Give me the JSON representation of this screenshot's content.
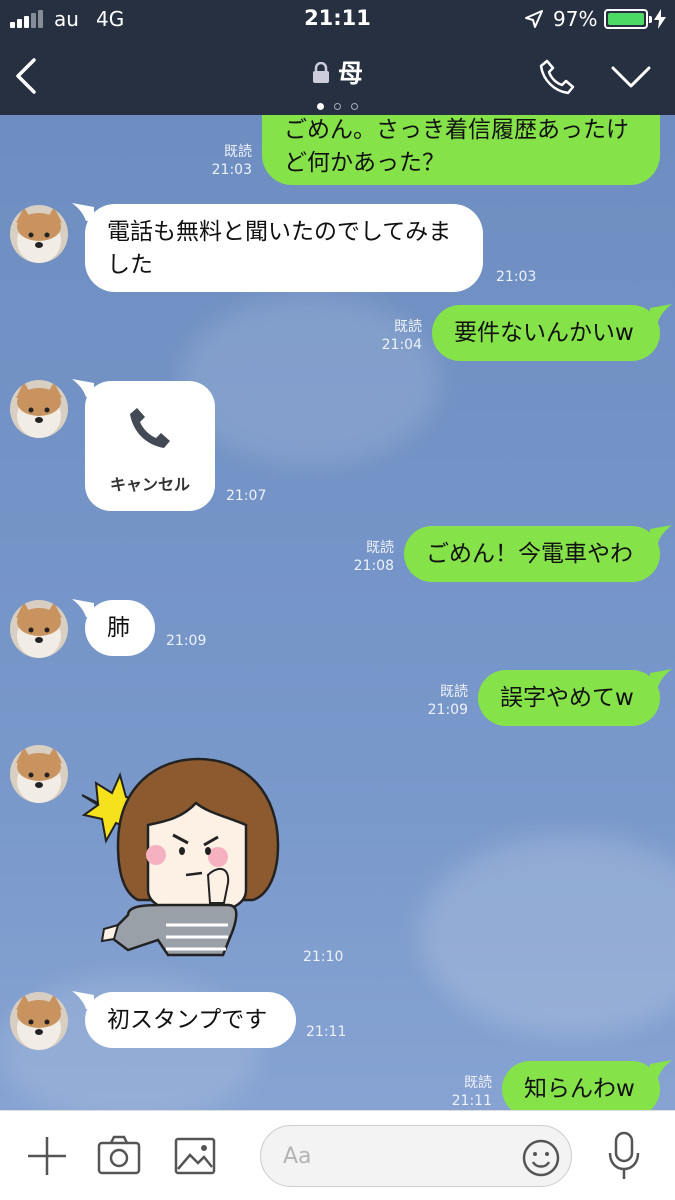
{
  "status": {
    "carrier": "au",
    "network": "4G",
    "time": "21:11",
    "battery": "97%"
  },
  "header": {
    "title": "母"
  },
  "read_label": "既読",
  "messages": [
    {
      "side": "out",
      "text": "ごめん。さっき着信履歴あったけ\nど何かあった？",
      "time": "21:03",
      "read": true
    },
    {
      "side": "in",
      "text": "電話も無料と聞いたのでしてみま\nした",
      "time": "21:03"
    },
    {
      "side": "out",
      "text": "要件ないんかいw",
      "time": "21:04",
      "read": true
    },
    {
      "side": "in",
      "type": "call",
      "label": "キャンセル",
      "time": "21:07"
    },
    {
      "side": "out",
      "text": "ごめん！今電車やわ",
      "time": "21:08",
      "read": true
    },
    {
      "side": "in",
      "text": "肺",
      "time": "21:09"
    },
    {
      "side": "out",
      "text": "誤字やめてw",
      "time": "21:09",
      "read": true
    },
    {
      "side": "in",
      "type": "sticker",
      "time": "21:10"
    },
    {
      "side": "in",
      "text": "初スタンプです",
      "time": "21:11"
    },
    {
      "side": "out",
      "text": "知らんわw",
      "time": "21:11",
      "read": true
    }
  ],
  "composer": {
    "placeholder": "Aa"
  },
  "colors": {
    "bubble_out": "#85e249",
    "bubble_in": "#ffffff",
    "header": "#263040",
    "chat_bg": "#7594c7"
  }
}
